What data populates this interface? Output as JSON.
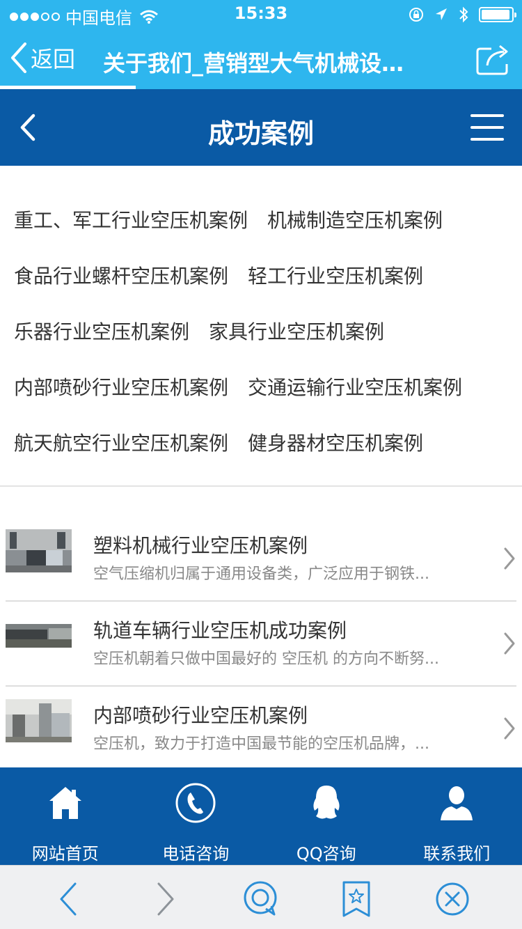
{
  "status_bar": {
    "carrier": "中国电信",
    "time": "15:33",
    "battery_level": 0.95
  },
  "browser_nav": {
    "back_label": "返回",
    "title": "关于我们_营销型大气机械设…",
    "load_progress": 0.26
  },
  "site_header": {
    "title": "成功案例"
  },
  "categories": [
    [
      "重工、军工行业空压机案例",
      "机械制造空压机案例"
    ],
    [
      "食品行业螺杆空压机案例",
      "轻工行业空压机案例"
    ],
    [
      "乐器行业空压机案例",
      "家具行业空压机案例"
    ],
    [
      "内部喷砂行业空压机案例",
      "交通运输行业空压机案例"
    ],
    [
      "航天航空行业空压机案例",
      "健身器材空压机案例"
    ]
  ],
  "cases": [
    {
      "title": "塑料机械行业空压机案例",
      "desc": "空气压缩机归属于通用设备类，广泛应用于钢铁..."
    },
    {
      "title": "轨道车辆行业空压机成功案例",
      "desc": "空压机朝着只做中国最好的 空压机 的方向不断努..."
    },
    {
      "title": "内部喷砂行业空压机案例",
      "desc": "空压机，致力于打造中国最节能的空压机品牌，..."
    }
  ],
  "footer_nav": [
    {
      "label": "网站首页",
      "icon": "home-icon"
    },
    {
      "label": "电话咨询",
      "icon": "phone-icon"
    },
    {
      "label": "QQ咨询",
      "icon": "qq-icon"
    },
    {
      "label": "联系我们",
      "icon": "person-icon"
    }
  ],
  "colors": {
    "top_bar": "#2eb6ee",
    "site_blue": "#0a5aa5",
    "toolbar_icon": "#2c8ed6"
  }
}
